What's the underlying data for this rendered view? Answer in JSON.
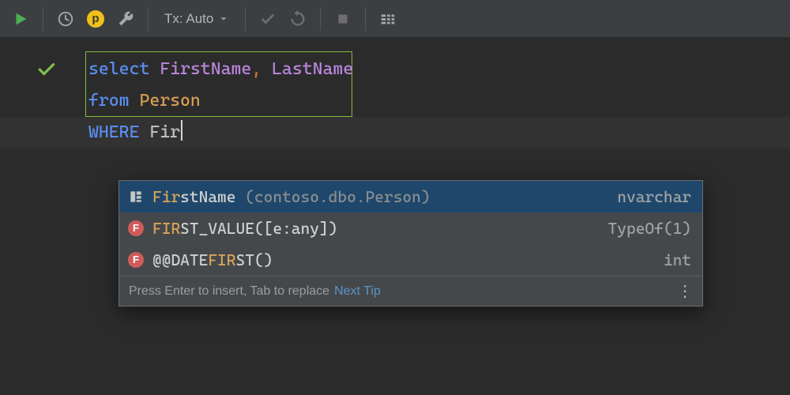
{
  "toolbar": {
    "tx_label": "Tx: Auto",
    "pbadge": "p"
  },
  "code": {
    "select": "select",
    "firstname": "FirstName",
    "comma": ",",
    "lastname": "LastName",
    "from": "from",
    "person": "Person",
    "where": "WHERE",
    "typed": "Fir"
  },
  "popup": {
    "items": [
      {
        "icon": "column",
        "match": "Fir",
        "rest": "stName",
        "qual": " (contoso.dbo.Person)",
        "type": "nvarchar",
        "selected": true
      },
      {
        "icon": "f",
        "match": "FIR",
        "rest": "ST_VALUE([e:any])",
        "qual": "",
        "type": "TypeOf(1)",
        "selected": false
      },
      {
        "icon": "f",
        "match": "@@DATEFIR",
        "match_pre": "@@DATE",
        "match_hi": "FIR",
        "rest": "ST()",
        "qual": "",
        "type": "int",
        "selected": false
      }
    ],
    "hint_text": "Press Enter to insert, Tab to replace",
    "hint_link": "Next Tip",
    "fbadge": "F"
  }
}
